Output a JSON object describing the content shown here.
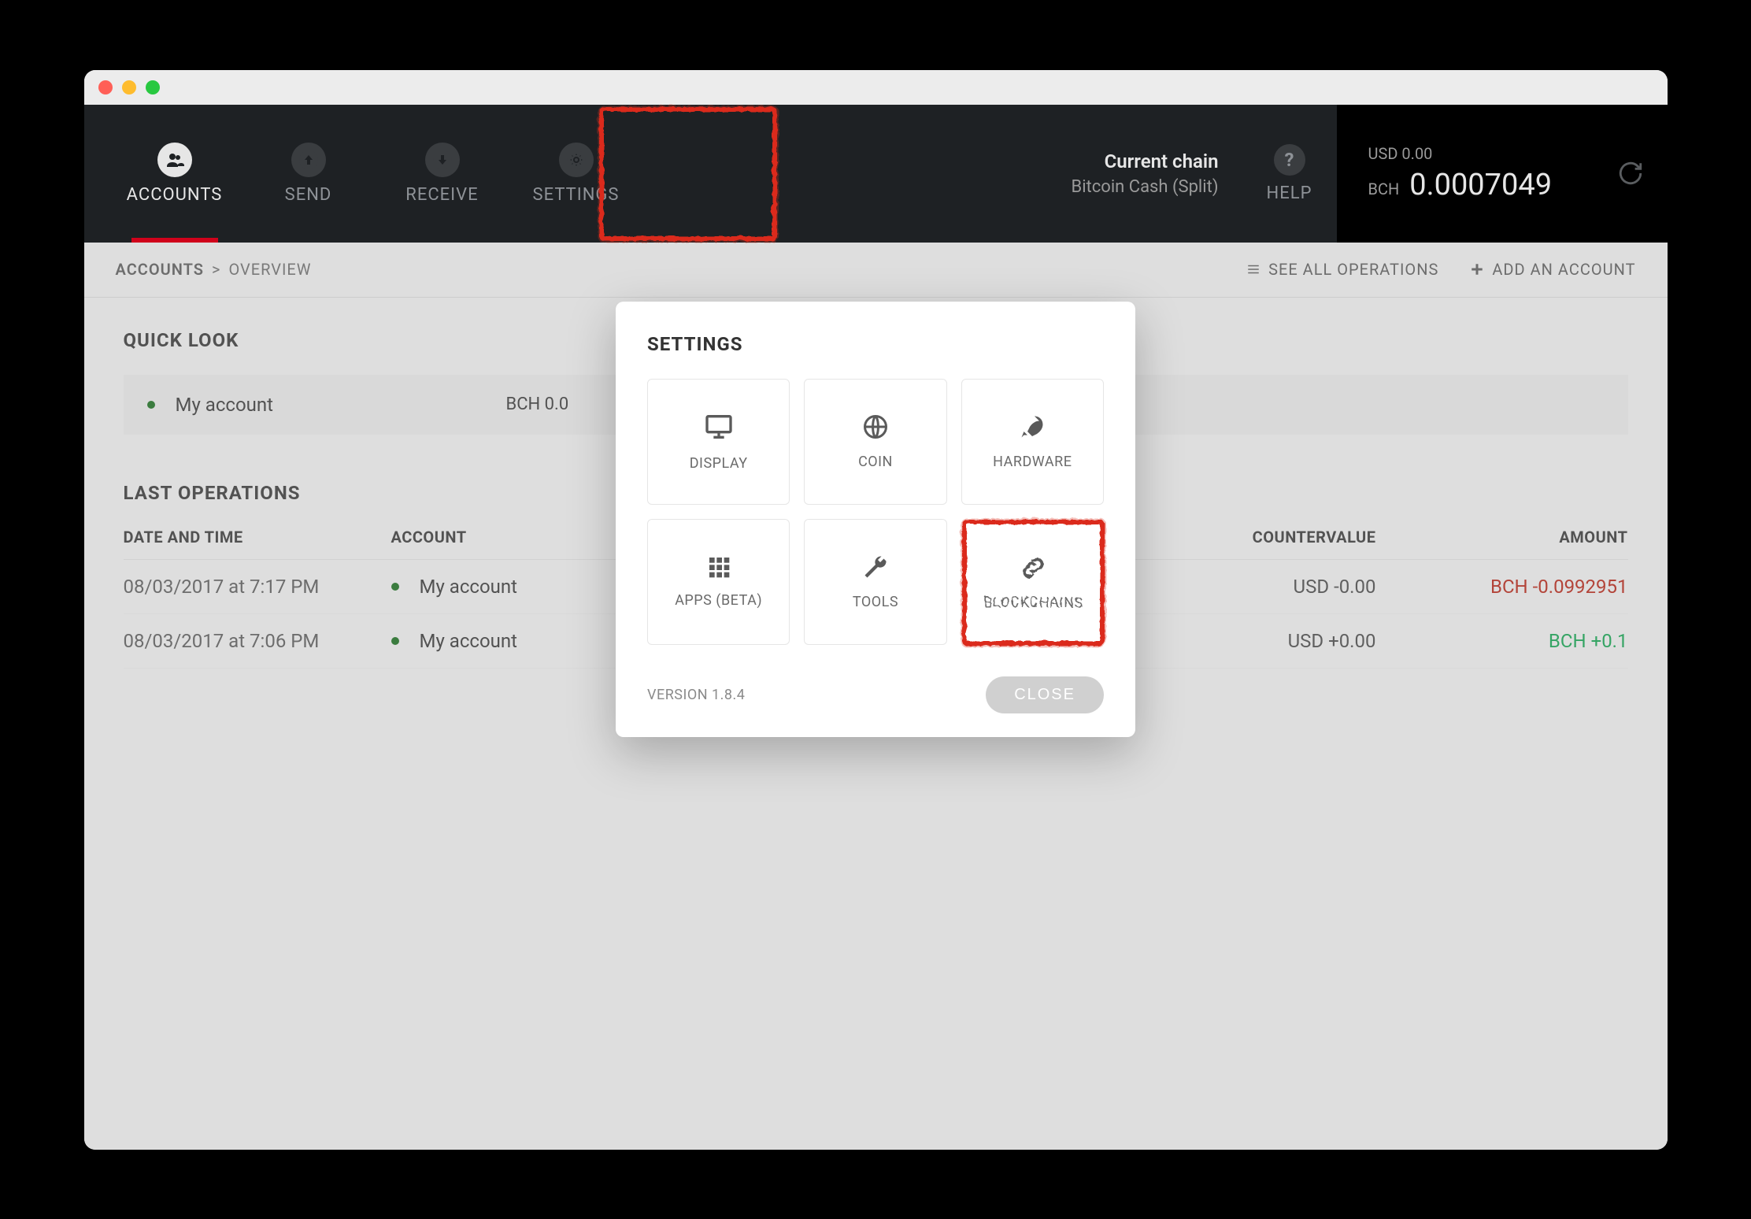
{
  "nav": {
    "items": [
      {
        "label": "ACCOUNTS",
        "icon": "users-icon",
        "active": true
      },
      {
        "label": "SEND",
        "icon": "arrow-up-icon",
        "active": false
      },
      {
        "label": "RECEIVE",
        "icon": "arrow-down-icon",
        "active": false
      },
      {
        "label": "SETTINGS",
        "icon": "gear-icon",
        "active": false
      }
    ]
  },
  "chain": {
    "title": "Current chain",
    "subtitle": "Bitcoin Cash (Split)"
  },
  "help_label": "HELP",
  "balance": {
    "usd_label": "USD 0.00",
    "bch_prefix": "BCH",
    "bch_amount": "0.0007049"
  },
  "breadcrumb": {
    "root": "ACCOUNTS",
    "sep": ">",
    "leaf": "OVERVIEW"
  },
  "subactions": {
    "see_all": "SEE ALL OPERATIONS",
    "add": "ADD AN ACCOUNT"
  },
  "quicklook_title": "QUICK LOOK",
  "account_row": {
    "name": "My account",
    "balance": "BCH 0.0"
  },
  "lastops_title": "LAST OPERATIONS",
  "columns": {
    "date": "DATE AND TIME",
    "account": "ACCOUNT",
    "countervalue": "COUNTERVALUE",
    "amount": "AMOUNT"
  },
  "ops": [
    {
      "date": "08/03/2017 at 7:17 PM",
      "account": "My account",
      "cv": "USD -0.00",
      "amount": "BCH -0.0992951",
      "sign": "neg"
    },
    {
      "date": "08/03/2017 at 7:06 PM",
      "account": "My account",
      "cv": "USD +0.00",
      "amount": "BCH +0.1",
      "sign": "pos"
    }
  ],
  "modal": {
    "title": "SETTINGS",
    "tiles": [
      {
        "label": "DISPLAY",
        "icon": "monitor-icon"
      },
      {
        "label": "COIN",
        "icon": "globe-icon"
      },
      {
        "label": "HARDWARE",
        "icon": "rocket-icon"
      },
      {
        "label": "APPS (BETA)",
        "icon": "grid-icon"
      },
      {
        "label": "TOOLS",
        "icon": "wrench-icon"
      },
      {
        "label": "BLOCKCHAINS",
        "icon": "chain-icon"
      }
    ],
    "version": "VERSION 1.8.4",
    "close": "CLOSE"
  }
}
